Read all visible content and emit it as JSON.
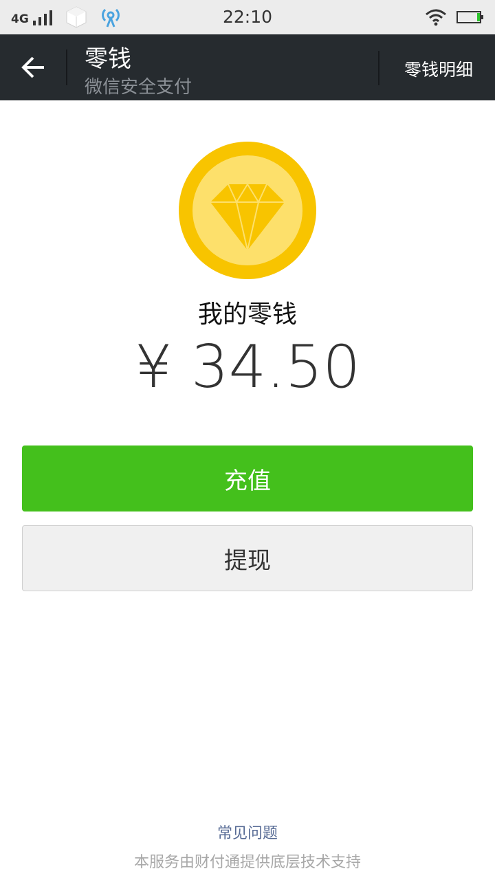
{
  "status_bar": {
    "network": "4G",
    "time": "22:10",
    "icons": [
      "signal-icon",
      "app-cube-icon",
      "hotspot-icon",
      "wifi-icon",
      "battery-icon"
    ]
  },
  "nav": {
    "title": "零钱",
    "subtitle": "微信安全支付",
    "detail_link": "零钱明细",
    "back_icon": "back-arrow-icon"
  },
  "balance": {
    "label": "我的零钱",
    "amount": "¥ 34.50",
    "icon": "diamond-coin-icon"
  },
  "actions": {
    "recharge": "充值",
    "withdraw": "提现"
  },
  "footer": {
    "faq": "常见问题",
    "note": "本服务由财付通提供底层技术支持"
  },
  "colors": {
    "nav_bg": "#262b2f",
    "primary_green": "#44c01c",
    "coin_outer": "#f8c400",
    "coin_inner": "#fde06b",
    "link_blue": "#576b95"
  }
}
